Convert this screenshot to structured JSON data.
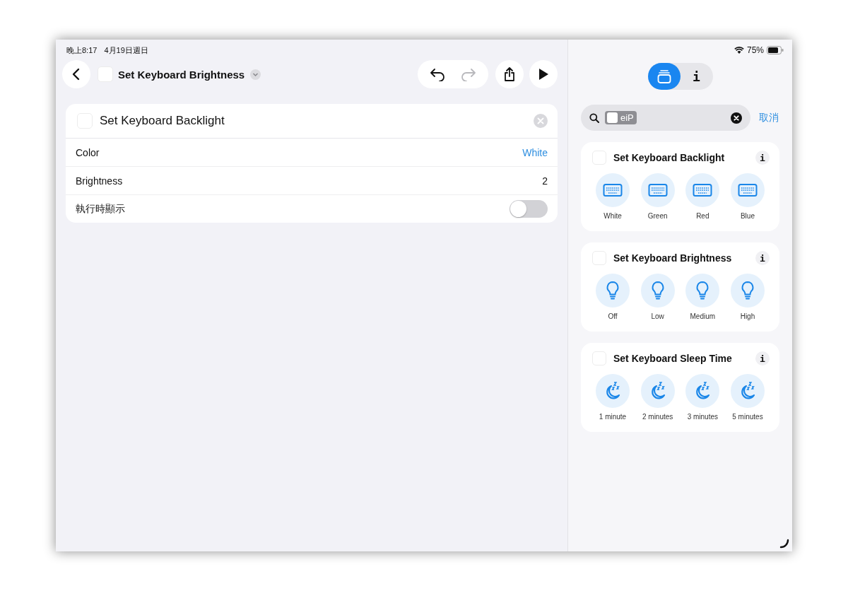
{
  "status_bar": {
    "time": "晚上8:17",
    "date": "4月19日週日",
    "battery": "75%"
  },
  "toolbar": {
    "title": "Set Keyboard Brightness",
    "buttons": [
      {
        "kind": "undo",
        "disabled": false
      },
      {
        "kind": "redo",
        "disabled": true
      }
    ]
  },
  "action": {
    "title": "Set Keyboard Backlight",
    "params": [
      {
        "kind": "value",
        "label": "Color",
        "value": "White",
        "tinted": true
      },
      {
        "kind": "value",
        "label": "Brightness",
        "value": "2",
        "tinted": false
      },
      {
        "kind": "toggle",
        "label": "執行時顯示",
        "on": false
      }
    ]
  },
  "sidebar": {
    "segments": [
      {
        "kind": "library",
        "selected": true
      },
      {
        "kind": "text",
        "label": "i",
        "selected": false
      }
    ],
    "search": {
      "token": "eiP"
    },
    "cancel": "取消",
    "groups": [
      {
        "title": "Set Keyboard Backlight",
        "info": "i",
        "actions": [
          "White",
          "Green",
          "Red",
          "Blue"
        ]
      },
      {
        "title": "Set Keyboard Brightness",
        "info": "i",
        "actions": [
          "Off",
          "Low",
          "Medium",
          "High"
        ]
      },
      {
        "title": "Set Keyboard Sleep Time",
        "info": "i",
        "actions": [
          "1 minute",
          "2 minutes",
          "3 minutes",
          "5 minutes"
        ]
      }
    ]
  }
}
